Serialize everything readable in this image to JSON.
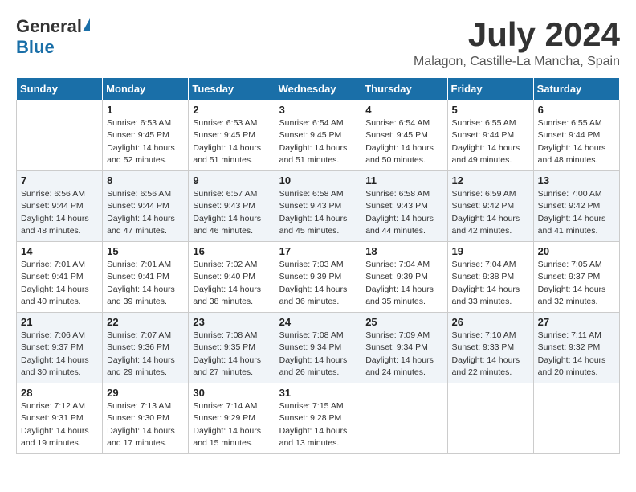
{
  "header": {
    "logo_general": "General",
    "logo_blue": "Blue",
    "month_year": "July 2024",
    "location": "Malagon, Castille-La Mancha, Spain"
  },
  "days_of_week": [
    "Sunday",
    "Monday",
    "Tuesday",
    "Wednesday",
    "Thursday",
    "Friday",
    "Saturday"
  ],
  "weeks": [
    [
      {
        "day": "",
        "sunrise": "",
        "sunset": "",
        "daylight": ""
      },
      {
        "day": "1",
        "sunrise": "Sunrise: 6:53 AM",
        "sunset": "Sunset: 9:45 PM",
        "daylight": "Daylight: 14 hours and 52 minutes."
      },
      {
        "day": "2",
        "sunrise": "Sunrise: 6:53 AM",
        "sunset": "Sunset: 9:45 PM",
        "daylight": "Daylight: 14 hours and 51 minutes."
      },
      {
        "day": "3",
        "sunrise": "Sunrise: 6:54 AM",
        "sunset": "Sunset: 9:45 PM",
        "daylight": "Daylight: 14 hours and 51 minutes."
      },
      {
        "day": "4",
        "sunrise": "Sunrise: 6:54 AM",
        "sunset": "Sunset: 9:45 PM",
        "daylight": "Daylight: 14 hours and 50 minutes."
      },
      {
        "day": "5",
        "sunrise": "Sunrise: 6:55 AM",
        "sunset": "Sunset: 9:44 PM",
        "daylight": "Daylight: 14 hours and 49 minutes."
      },
      {
        "day": "6",
        "sunrise": "Sunrise: 6:55 AM",
        "sunset": "Sunset: 9:44 PM",
        "daylight": "Daylight: 14 hours and 48 minutes."
      }
    ],
    [
      {
        "day": "7",
        "sunrise": "Sunrise: 6:56 AM",
        "sunset": "Sunset: 9:44 PM",
        "daylight": "Daylight: 14 hours and 48 minutes."
      },
      {
        "day": "8",
        "sunrise": "Sunrise: 6:56 AM",
        "sunset": "Sunset: 9:44 PM",
        "daylight": "Daylight: 14 hours and 47 minutes."
      },
      {
        "day": "9",
        "sunrise": "Sunrise: 6:57 AM",
        "sunset": "Sunset: 9:43 PM",
        "daylight": "Daylight: 14 hours and 46 minutes."
      },
      {
        "day": "10",
        "sunrise": "Sunrise: 6:58 AM",
        "sunset": "Sunset: 9:43 PM",
        "daylight": "Daylight: 14 hours and 45 minutes."
      },
      {
        "day": "11",
        "sunrise": "Sunrise: 6:58 AM",
        "sunset": "Sunset: 9:43 PM",
        "daylight": "Daylight: 14 hours and 44 minutes."
      },
      {
        "day": "12",
        "sunrise": "Sunrise: 6:59 AM",
        "sunset": "Sunset: 9:42 PM",
        "daylight": "Daylight: 14 hours and 42 minutes."
      },
      {
        "day": "13",
        "sunrise": "Sunrise: 7:00 AM",
        "sunset": "Sunset: 9:42 PM",
        "daylight": "Daylight: 14 hours and 41 minutes."
      }
    ],
    [
      {
        "day": "14",
        "sunrise": "Sunrise: 7:01 AM",
        "sunset": "Sunset: 9:41 PM",
        "daylight": "Daylight: 14 hours and 40 minutes."
      },
      {
        "day": "15",
        "sunrise": "Sunrise: 7:01 AM",
        "sunset": "Sunset: 9:41 PM",
        "daylight": "Daylight: 14 hours and 39 minutes."
      },
      {
        "day": "16",
        "sunrise": "Sunrise: 7:02 AM",
        "sunset": "Sunset: 9:40 PM",
        "daylight": "Daylight: 14 hours and 38 minutes."
      },
      {
        "day": "17",
        "sunrise": "Sunrise: 7:03 AM",
        "sunset": "Sunset: 9:39 PM",
        "daylight": "Daylight: 14 hours and 36 minutes."
      },
      {
        "day": "18",
        "sunrise": "Sunrise: 7:04 AM",
        "sunset": "Sunset: 9:39 PM",
        "daylight": "Daylight: 14 hours and 35 minutes."
      },
      {
        "day": "19",
        "sunrise": "Sunrise: 7:04 AM",
        "sunset": "Sunset: 9:38 PM",
        "daylight": "Daylight: 14 hours and 33 minutes."
      },
      {
        "day": "20",
        "sunrise": "Sunrise: 7:05 AM",
        "sunset": "Sunset: 9:37 PM",
        "daylight": "Daylight: 14 hours and 32 minutes."
      }
    ],
    [
      {
        "day": "21",
        "sunrise": "Sunrise: 7:06 AM",
        "sunset": "Sunset: 9:37 PM",
        "daylight": "Daylight: 14 hours and 30 minutes."
      },
      {
        "day": "22",
        "sunrise": "Sunrise: 7:07 AM",
        "sunset": "Sunset: 9:36 PM",
        "daylight": "Daylight: 14 hours and 29 minutes."
      },
      {
        "day": "23",
        "sunrise": "Sunrise: 7:08 AM",
        "sunset": "Sunset: 9:35 PM",
        "daylight": "Daylight: 14 hours and 27 minutes."
      },
      {
        "day": "24",
        "sunrise": "Sunrise: 7:08 AM",
        "sunset": "Sunset: 9:34 PM",
        "daylight": "Daylight: 14 hours and 26 minutes."
      },
      {
        "day": "25",
        "sunrise": "Sunrise: 7:09 AM",
        "sunset": "Sunset: 9:34 PM",
        "daylight": "Daylight: 14 hours and 24 minutes."
      },
      {
        "day": "26",
        "sunrise": "Sunrise: 7:10 AM",
        "sunset": "Sunset: 9:33 PM",
        "daylight": "Daylight: 14 hours and 22 minutes."
      },
      {
        "day": "27",
        "sunrise": "Sunrise: 7:11 AM",
        "sunset": "Sunset: 9:32 PM",
        "daylight": "Daylight: 14 hours and 20 minutes."
      }
    ],
    [
      {
        "day": "28",
        "sunrise": "Sunrise: 7:12 AM",
        "sunset": "Sunset: 9:31 PM",
        "daylight": "Daylight: 14 hours and 19 minutes."
      },
      {
        "day": "29",
        "sunrise": "Sunrise: 7:13 AM",
        "sunset": "Sunset: 9:30 PM",
        "daylight": "Daylight: 14 hours and 17 minutes."
      },
      {
        "day": "30",
        "sunrise": "Sunrise: 7:14 AM",
        "sunset": "Sunset: 9:29 PM",
        "daylight": "Daylight: 14 hours and 15 minutes."
      },
      {
        "day": "31",
        "sunrise": "Sunrise: 7:15 AM",
        "sunset": "Sunset: 9:28 PM",
        "daylight": "Daylight: 14 hours and 13 minutes."
      },
      {
        "day": "",
        "sunrise": "",
        "sunset": "",
        "daylight": ""
      },
      {
        "day": "",
        "sunrise": "",
        "sunset": "",
        "daylight": ""
      },
      {
        "day": "",
        "sunrise": "",
        "sunset": "",
        "daylight": ""
      }
    ]
  ]
}
